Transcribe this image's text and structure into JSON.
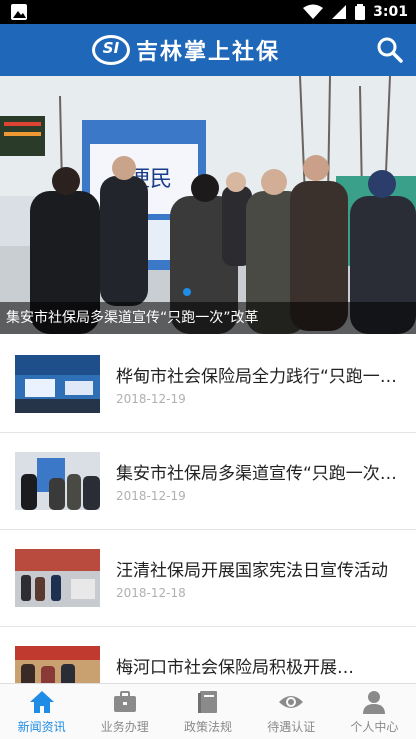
{
  "status_bar": {
    "time": "3:01"
  },
  "app_bar": {
    "logo_text": "SI",
    "title": "吉林掌上社保"
  },
  "banner": {
    "caption": "集安市社保局多渠道宣传“只跑一次”改革",
    "sign_text": "便民"
  },
  "news": [
    {
      "title": "桦甸市社会保险局全力践行“只跑一次”改革",
      "date": "2018-12-19"
    },
    {
      "title": "集安市社保局多渠道宣传“只跑一次”改革",
      "date": "2018-12-19"
    },
    {
      "title": "汪清社保局开展国家宪法日宣传活动",
      "date": "2018-12-18"
    },
    {
      "title": "梅河口市社会保险局积极开展…",
      "date": ""
    }
  ],
  "tabs": [
    {
      "label": "新闻资讯",
      "icon": "home-icon",
      "active": true
    },
    {
      "label": "业务办理",
      "icon": "briefcase-icon",
      "active": false
    },
    {
      "label": "政策法规",
      "icon": "book-icon",
      "active": false
    },
    {
      "label": "待遇认证",
      "icon": "eye-icon",
      "active": false
    },
    {
      "label": "个人中心",
      "icon": "person-icon",
      "active": false
    }
  ],
  "colors": {
    "primary": "#1f67b8",
    "accent": "#1f8de6",
    "inactive": "#8a8a8a"
  }
}
